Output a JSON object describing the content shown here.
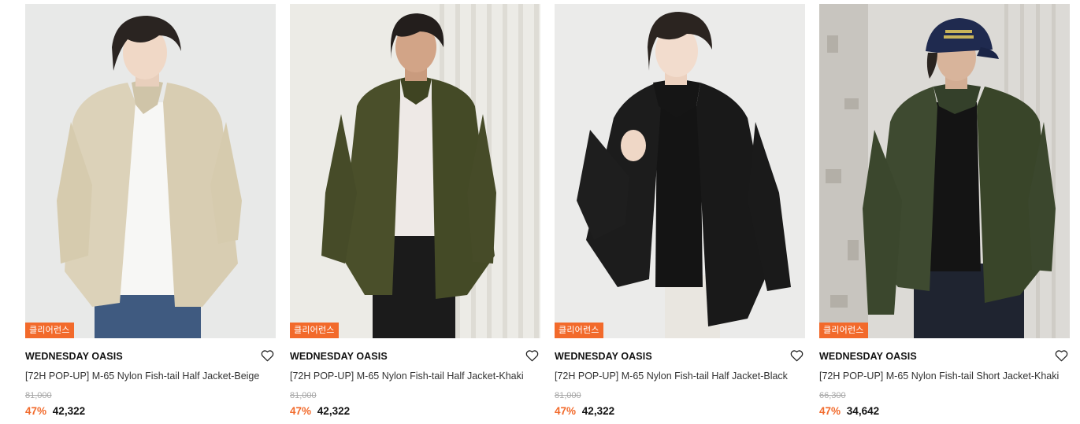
{
  "products": [
    {
      "badge": "클리어런스",
      "brand": "WEDNESDAY OASIS",
      "title": "[72H POP-UP] M-65 Nylon Fish-tail Half Jacket-Beige",
      "original_price": "81,000",
      "discount": "47%",
      "price": "42,322",
      "bg_color": "#e8e9e8",
      "jacket_color": "#dcd2b9",
      "pants_color": "#3f5a80"
    },
    {
      "badge": "클리어런스",
      "brand": "WEDNESDAY OASIS",
      "title": "[72H POP-UP] M-65 Nylon Fish-tail Half Jacket-Khaki",
      "original_price": "81,000",
      "discount": "47%",
      "price": "42,322",
      "bg_color": "#ecebe6",
      "jacket_color": "#4a4f2a",
      "pants_color": "#1b1b1b"
    },
    {
      "badge": "클리어런스",
      "brand": "WEDNESDAY OASIS",
      "title": "[72H POP-UP] M-65 Nylon Fish-tail Half Jacket-Black",
      "original_price": "81,000",
      "discount": "47%",
      "price": "42,322",
      "bg_color": "#ebebea",
      "jacket_color": "#1c1c1c",
      "pants_color": "#e9e6e0"
    },
    {
      "badge": "클리어런스",
      "brand": "WEDNESDAY OASIS",
      "title": "[72H POP-UP] M-65 Nylon Fish-tail Short Jacket-Khaki",
      "original_price": "66,300",
      "discount": "47%",
      "price": "34,642",
      "bg_color": "#dcdad6",
      "jacket_color": "#3e4a30",
      "pants_color": "#1f2430"
    }
  ],
  "colors": {
    "accent": "#f26a2b",
    "strike": "#a6a6a6",
    "text": "#111111"
  },
  "icons": {
    "wishlist": "heart-outline-icon"
  }
}
